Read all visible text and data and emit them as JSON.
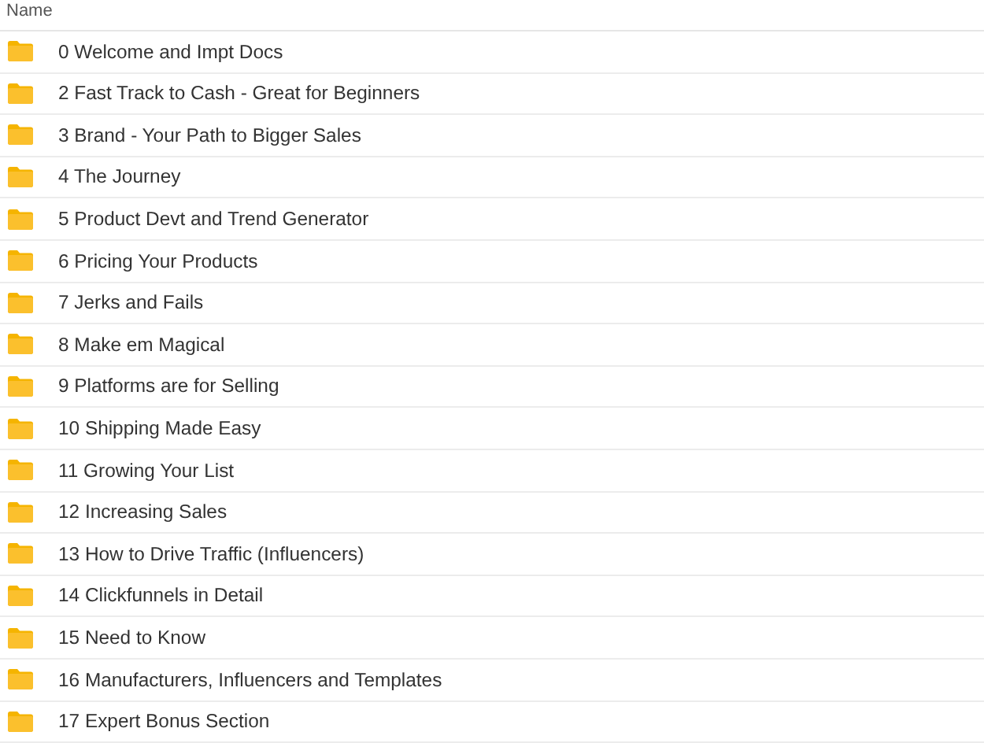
{
  "table": {
    "columns": [
      "Name"
    ],
    "rows": [
      {
        "name": "0 Welcome and Impt Docs"
      },
      {
        "name": "2 Fast Track to Cash - Great for Beginners"
      },
      {
        "name": "3 Brand - Your Path to Bigger Sales"
      },
      {
        "name": "4 The Journey"
      },
      {
        "name": "5 Product Devt and Trend Generator"
      },
      {
        "name": "6 Pricing Your Products"
      },
      {
        "name": "7 Jerks and Fails"
      },
      {
        "name": "8 Make em Magical"
      },
      {
        "name": "9 Platforms are for Selling"
      },
      {
        "name": "10 Shipping Made Easy"
      },
      {
        "name": "11 Growing Your List"
      },
      {
        "name": "12 Increasing Sales"
      },
      {
        "name": "13 How to Drive Traffic (Influencers)"
      },
      {
        "name": "14 Clickfunnels in Detail"
      },
      {
        "name": "15 Need to Know"
      },
      {
        "name": "16 Manufacturers, Influencers and Templates"
      },
      {
        "name": "17 Expert Bonus Section"
      }
    ]
  }
}
